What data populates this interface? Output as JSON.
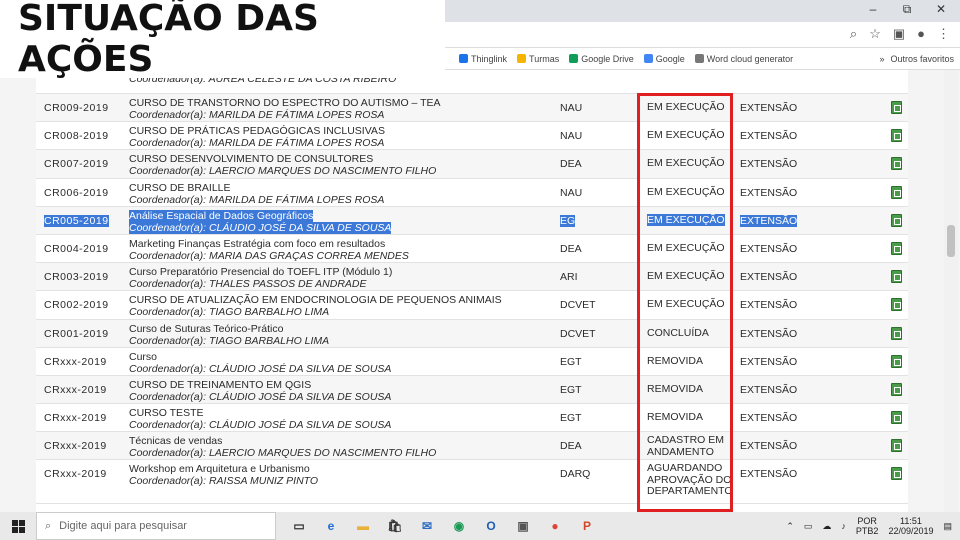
{
  "slide": {
    "title": "SITUAÇÃO DAS AÇÕES"
  },
  "window": {
    "minimize": "–",
    "restore": "⧉",
    "close": "✕"
  },
  "bookmarks": [
    {
      "label": "Thinglink",
      "color": "#1a73e8"
    },
    {
      "label": "Turmas",
      "color": "#f4b400"
    },
    {
      "label": "Google Drive",
      "color": "#0f9d58"
    },
    {
      "label": "Google",
      "color": "#4285f4"
    },
    {
      "label": "Word cloud generator",
      "color": "#777777"
    }
  ],
  "bookmarks_more": "»",
  "bookmarks_other": "Outros favoritos",
  "table": {
    "rows": [
      {
        "code": "",
        "title": "",
        "coord": "Coordenador(a): AUREA CELESTE DA COSTA RIBEIRO",
        "unit": "",
        "status": "",
        "type": ""
      },
      {
        "code": "CR009-2019",
        "title": "CURSO DE TRANSTORNO DO ESPECTRO DO AUTISMO – TEA",
        "coord": "Coordenador(a): MARILDA DE FÁTIMA LOPES ROSA",
        "unit": "NAU",
        "status": "EM EXECUÇÃO",
        "type": "EXTENSÃO"
      },
      {
        "code": "CR008-2019",
        "title": "CURSO DE PRÁTICAS PEDAGÓGICAS INCLUSIVAS",
        "coord": "Coordenador(a): MARILDA DE FÁTIMA LOPES ROSA",
        "unit": "NAU",
        "status": "EM EXECUÇÃO",
        "type": "EXTENSÃO"
      },
      {
        "code": "CR007-2019",
        "title": "CURSO DESENVOLVIMENTO DE CONSULTORES",
        "coord": "Coordenador(a): LAERCIO MARQUES DO NASCIMENTO FILHO",
        "unit": "DEA",
        "status": "EM EXECUÇÃO",
        "type": "EXTENSÃO"
      },
      {
        "code": "CR006-2019",
        "title": "CURSO DE BRAILLE",
        "coord": "Coordenador(a): MARILDA DE FÁTIMA LOPES ROSA",
        "unit": "NAU",
        "status": "EM EXECUÇÃO",
        "type": "EXTENSÃO"
      },
      {
        "code": "CR005-2019",
        "title": "Análise Espacial de Dados Geográficos",
        "coord": "Coordenador(a): CLÁUDIO JOSÉ DA SILVA DE SOUSA",
        "unit": "EG",
        "status": "EM EXECUÇÃO",
        "type": "EXTENSÃO",
        "selected": true
      },
      {
        "code": "CR004-2019",
        "title": "Marketing Finanças Estratégia com foco em resultados",
        "coord": "Coordenador(a): MARIA DAS GRAÇAS CORREA MENDES",
        "unit": "DEA",
        "status": "EM EXECUÇÃO",
        "type": "EXTENSÃO"
      },
      {
        "code": "CR003-2019",
        "title": "Curso Preparatório Presencial do TOEFL ITP (Módulo 1)",
        "coord": "Coordenador(a): THALES PASSOS DE ANDRADE",
        "unit": "ARI",
        "status": "EM EXECUÇÃO",
        "type": "EXTENSÃO"
      },
      {
        "code": "CR002-2019",
        "title": "CURSO DE ATUALIZAÇÃO EM ENDOCRINOLOGIA DE PEQUENOS ANIMAIS",
        "coord": "Coordenador(a): TIAGO BARBALHO LIMA",
        "unit": "DCVET",
        "status": "EM EXECUÇÃO",
        "type": "EXTENSÃO"
      },
      {
        "code": "CR001-2019",
        "title": "Curso de Suturas Teórico-Prático",
        "coord": "Coordenador(a): TIAGO BARBALHO LIMA",
        "unit": "DCVET",
        "status": "CONCLUÍDA",
        "type": "EXTENSÃO"
      },
      {
        "code": "CRxxx-2019",
        "title": "Curso",
        "coord": "Coordenador(a): CLÁUDIO JOSÉ DA SILVA DE SOUSA",
        "unit": "EGT",
        "status": "REMOVIDA",
        "type": "EXTENSÃO"
      },
      {
        "code": "CRxxx-2019",
        "title": "CURSO DE TREINAMENTO EM QGIS",
        "coord": "Coordenador(a): CLÁUDIO JOSÉ DA SILVA DE SOUSA",
        "unit": "EGT",
        "status": "REMOVIDA",
        "type": "EXTENSÃO"
      },
      {
        "code": "CRxxx-2019",
        "title": "CURSO TESTE",
        "coord": "Coordenador(a): CLÁUDIO JOSÉ DA SILVA DE SOUSA",
        "unit": "EGT",
        "status": "REMOVIDA",
        "type": "EXTENSÃO"
      },
      {
        "code": "CRxxx-2019",
        "title": "Técnicas de vendas",
        "coord": "Coordenador(a): LAERCIO MARQUES DO NASCIMENTO FILHO",
        "unit": "DEA",
        "status": "CADASTRO EM ANDAMENTO",
        "type": "EXTENSÃO"
      },
      {
        "code": "CRxxx-2019",
        "title": "Workshop em Arquitetura e Urbanismo",
        "coord": "Coordenador(a): RAISSA MUNIZ PINTO",
        "unit": "DARQ",
        "status": "AGUARDANDO APROVAÇÃO DO DEPARTAMENTO",
        "type": "EXTENSÃO"
      }
    ]
  },
  "taskbar": {
    "search_placeholder": "Digite aqui para pesquisar",
    "lang_line1": "POR",
    "lang_line2": "PTB2",
    "time": "11:51",
    "date": "22/09/2019",
    "apps": [
      {
        "name": "task-view-icon",
        "glyph": "▭",
        "color": "#333333"
      },
      {
        "name": "edge-icon",
        "glyph": "e",
        "color": "#1f6fd1"
      },
      {
        "name": "file-explorer-icon",
        "glyph": "▬",
        "color": "#e8b13a"
      },
      {
        "name": "store-icon",
        "glyph": "🛍",
        "color": "#333333"
      },
      {
        "name": "mail-icon",
        "glyph": "✉",
        "color": "#2c6bbf"
      },
      {
        "name": "chrome-app-icon",
        "glyph": "◉",
        "color": "#1a9a55"
      },
      {
        "name": "outlook-icon",
        "glyph": "O",
        "color": "#1d5fb7"
      },
      {
        "name": "photos-icon",
        "glyph": "▣",
        "color": "#555555"
      },
      {
        "name": "chrome-icon",
        "glyph": "●",
        "color": "#db4437"
      },
      {
        "name": "powerpoint-icon",
        "glyph": "P",
        "color": "#d24726"
      }
    ]
  }
}
